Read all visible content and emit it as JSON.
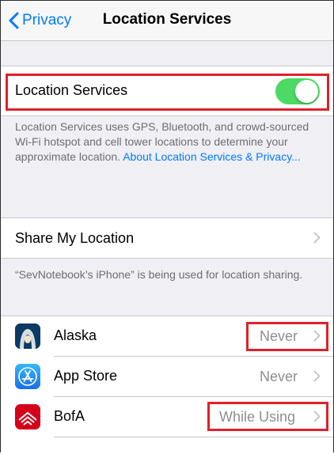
{
  "nav": {
    "back_label": "Privacy",
    "title": "Location Services"
  },
  "location_services": {
    "label": "Location Services",
    "enabled": true,
    "description": "Location Services uses GPS, Bluetooth, and crowd-sourced Wi-Fi hotspot and cell tower locations to determine your approximate location.",
    "link_text": "About Location Services & Privacy..."
  },
  "share": {
    "label": "Share My Location",
    "footer": "“SevNotebook’s iPhone” is being used for location sharing."
  },
  "apps": [
    {
      "name": "Alaska",
      "value": "Never",
      "icon": "alaska-icon"
    },
    {
      "name": "App Store",
      "value": "Never",
      "icon": "app-store-icon"
    },
    {
      "name": "BofA",
      "value": "While Using",
      "icon": "bofa-icon"
    }
  ],
  "colors": {
    "accent": "#007aff",
    "toggle_on": "#4cd964",
    "highlight": "#e0202a",
    "background": "#efeff4"
  }
}
